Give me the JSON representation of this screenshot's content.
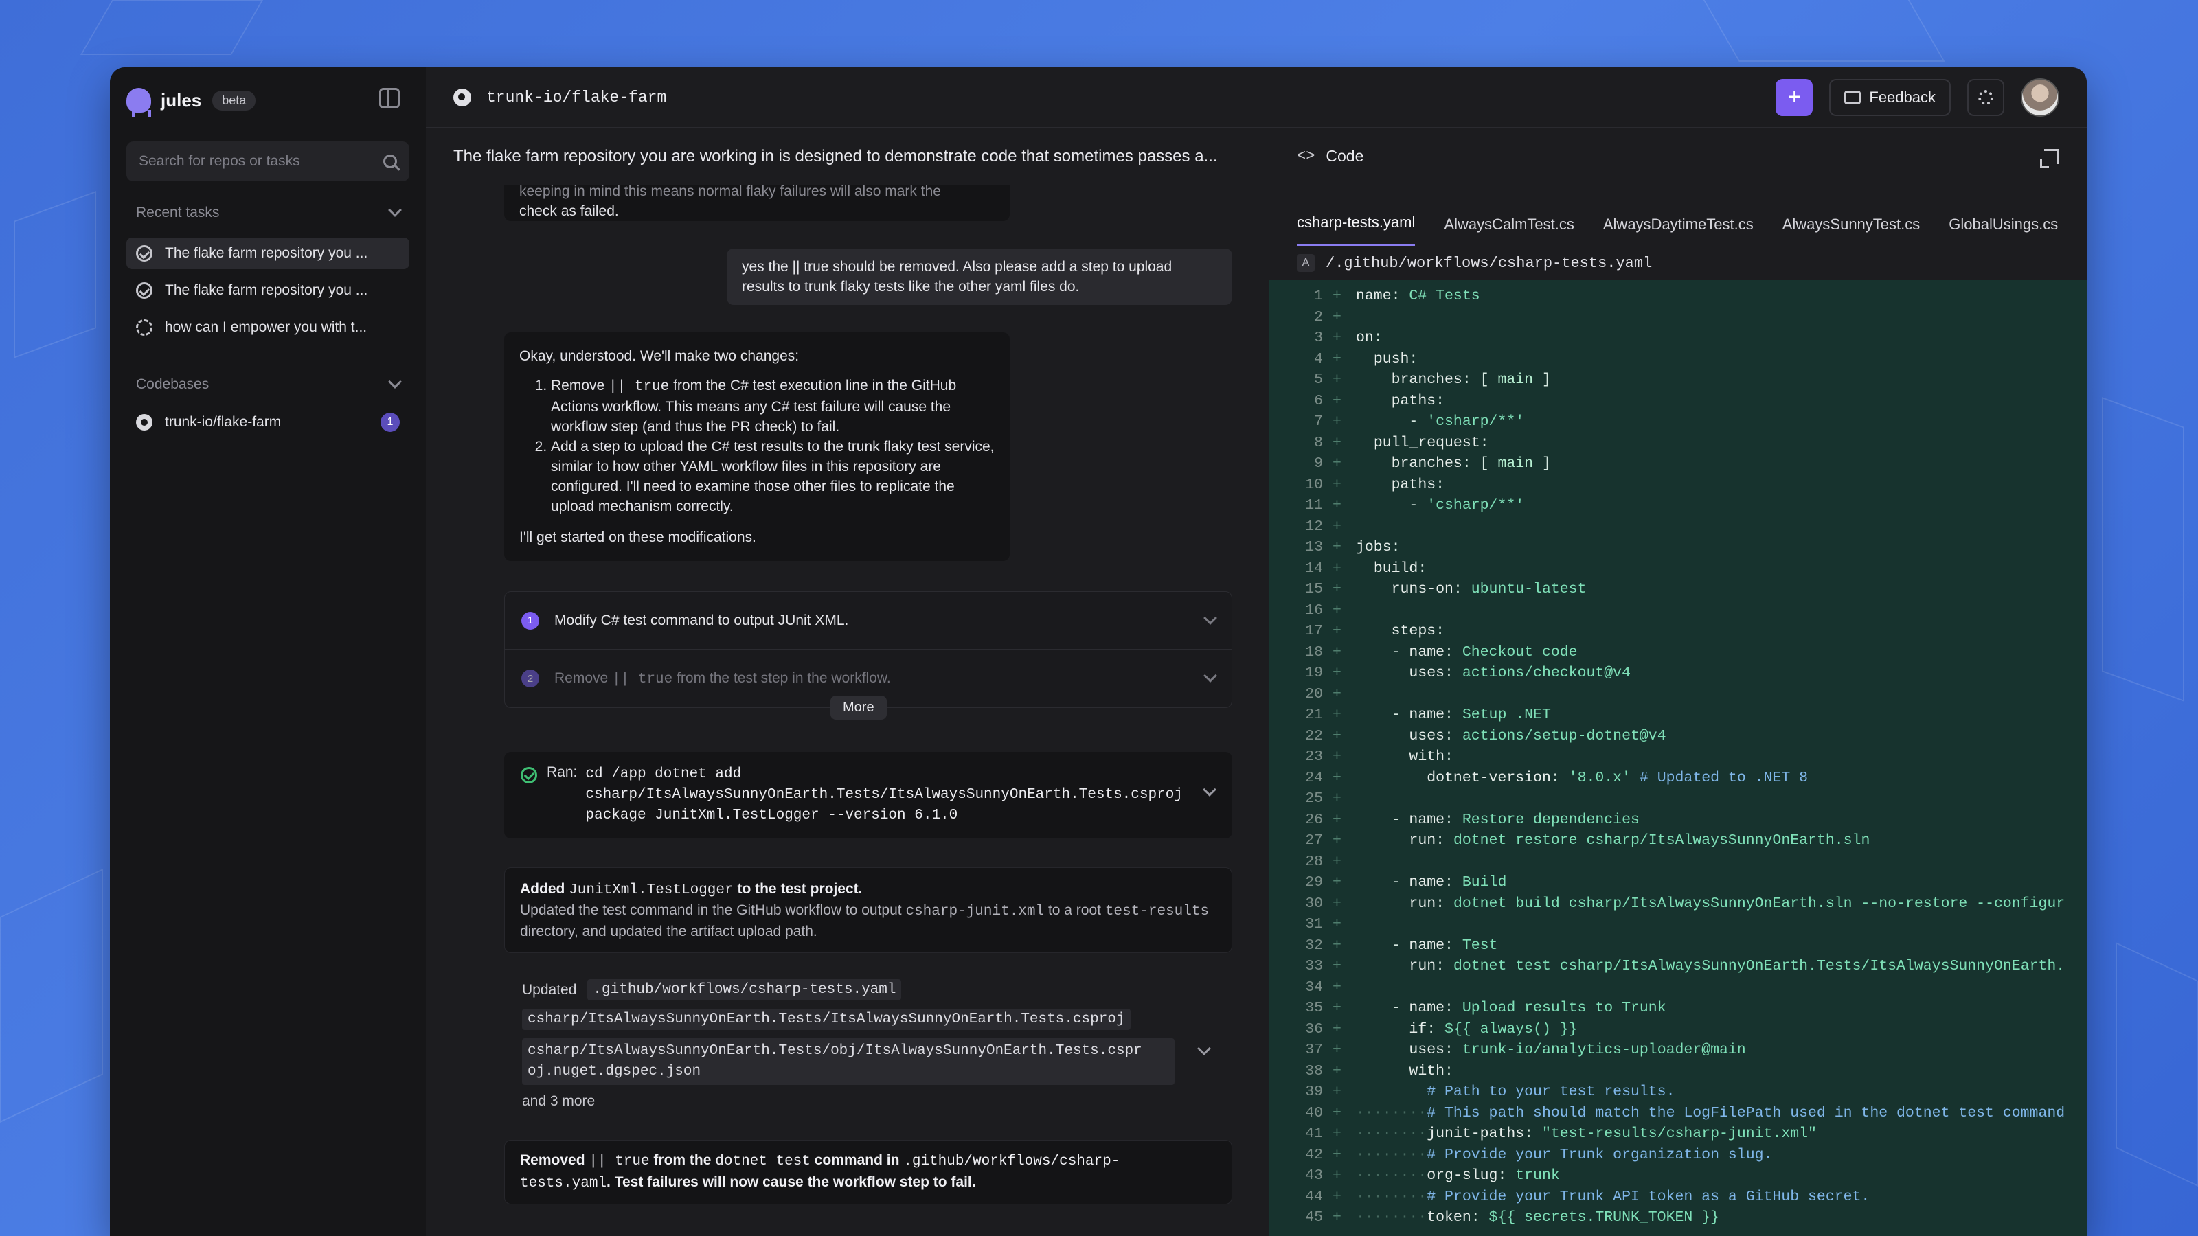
{
  "sidebar": {
    "brand": "jules",
    "badge": "beta",
    "search_placeholder": "Search for repos or tasks",
    "recent_tasks_label": "Recent tasks",
    "tasks": [
      {
        "label": "The flake farm repository you ...",
        "status": "done"
      },
      {
        "label": "The flake farm repository you ...",
        "status": "done"
      },
      {
        "label": "how can I empower you with t...",
        "status": "syncing"
      }
    ],
    "codebases_label": "Codebases",
    "codebases": [
      {
        "name": "trunk-io/flake-farm",
        "count": "1"
      }
    ]
  },
  "topbar": {
    "repo": "trunk-io/flake-farm",
    "plus": "+",
    "feedback": "Feedback"
  },
  "chat": {
    "title": "The flake farm repository you are working in is designed to demonstrate code that sometimes passes a...",
    "prev_agent_tail": {
      "ghost": "keeping in mind this means normal flaky failures will also mark the",
      "text": "check as failed."
    },
    "user_message": "yes the || true should be removed. Also please add a step to upload results to trunk flaky tests like the other yaml files do.",
    "agent_reply": {
      "intro": "Okay, understood. We'll make two changes:",
      "item1_a": "Remove ",
      "item1_code": "|| true",
      "item1_b": " from the C# test execution line in the GitHub Actions workflow. This means any C# test failure will cause the workflow step (and thus the PR check) to fail.",
      "item2": "Add a step to upload the C# test results to the trunk flaky test service, similar to how other YAML workflow files in this repository are configured. I'll need to examine those other files to replicate the upload mechanism correctly.",
      "outro": "I'll get started on these modifications."
    },
    "plan": {
      "steps": [
        {
          "num": "1",
          "text": "Modify C# test command to output JUnit XML."
        },
        {
          "num": "2",
          "text_a": "Remove ",
          "code": "|| true",
          "text_b": " from the test step in the workflow."
        }
      ],
      "more": "More"
    },
    "ran": {
      "label": "Ran:",
      "command": "cd /app dotnet add\ncsharp/ItsAlwaysSunnyOnEarth.Tests/ItsAlwaysSunnyOnEarth.Tests.csproj\npackage JunitXml.TestLogger --version 6.1.0"
    },
    "added": {
      "a": "Added ",
      "code": "JunitXml.TestLogger",
      "b": " to the test project.",
      "desc_a": "Updated the test command in the GitHub workflow to output ",
      "desc_code1": "csharp-junit.xml",
      "desc_b": " to a root ",
      "desc_code2": "test-results",
      "desc_c": " directory, and updated the artifact upload path."
    },
    "updated": {
      "label": "Updated",
      "files": [
        ".github/workflows/csharp-tests.yaml",
        "csharp/ItsAlwaysSunnyOnEarth.Tests/ItsAlwaysSunnyOnEarth.Tests.csproj",
        "csharp/ItsAlwaysSunnyOnEarth.Tests/obj/ItsAlwaysSunnyOnEarth.Tests.cspr\noj.nuget.dgspec.json"
      ],
      "and_more": "and 3 more"
    },
    "removed": {
      "a": "Removed ",
      "code1": "|| true",
      "b": " from the ",
      "code2": "dotnet test",
      "c": " command in ",
      "code3": ".github/workflows/csharp-\ntests.yaml",
      "d": ". Test failures will now cause the workflow step to fail."
    }
  },
  "code": {
    "header": "Code",
    "tabs": [
      "csharp-tests.yaml",
      "AlwaysCalmTest.cs",
      "AlwaysDaytimeTest.cs",
      "AlwaysSunnyTest.cs",
      "GlobalUsings.cs"
    ],
    "active_tab": 0,
    "file_badge": "A",
    "file_path": "/.github/workflows/csharp-tests.yaml",
    "lines": [
      [
        [
          "k",
          "name"
        ],
        [
          "p",
          ": "
        ],
        [
          "s",
          "C# Tests"
        ]
      ],
      [],
      [
        [
          "k",
          "on"
        ],
        [
          "p",
          ":"
        ]
      ],
      [
        [
          "p",
          "  "
        ],
        [
          "k",
          "push"
        ],
        [
          "p",
          ":"
        ]
      ],
      [
        [
          "p",
          "    "
        ],
        [
          "k",
          "branches"
        ],
        [
          "p",
          ": [ "
        ],
        [
          "v",
          "main"
        ],
        [
          "p",
          " ]"
        ]
      ],
      [
        [
          "p",
          "    "
        ],
        [
          "k",
          "paths"
        ],
        [
          "p",
          ":"
        ]
      ],
      [
        [
          "p",
          "      - "
        ],
        [
          "s",
          "'csharp/**'"
        ]
      ],
      [
        [
          "p",
          "  "
        ],
        [
          "k",
          "pull_request"
        ],
        [
          "p",
          ":"
        ]
      ],
      [
        [
          "p",
          "    "
        ],
        [
          "k",
          "branches"
        ],
        [
          "p",
          ": [ "
        ],
        [
          "v",
          "main"
        ],
        [
          "p",
          " ]"
        ]
      ],
      [
        [
          "p",
          "    "
        ],
        [
          "k",
          "paths"
        ],
        [
          "p",
          ":"
        ]
      ],
      [
        [
          "p",
          "      - "
        ],
        [
          "s",
          "'csharp/**'"
        ]
      ],
      [],
      [
        [
          "k",
          "jobs"
        ],
        [
          "p",
          ":"
        ]
      ],
      [
        [
          "p",
          "  "
        ],
        [
          "k",
          "build"
        ],
        [
          "p",
          ":"
        ]
      ],
      [
        [
          "p",
          "    "
        ],
        [
          "k",
          "runs-on"
        ],
        [
          "p",
          ": "
        ],
        [
          "s",
          "ubuntu-latest"
        ]
      ],
      [],
      [
        [
          "p",
          "    "
        ],
        [
          "k",
          "steps"
        ],
        [
          "p",
          ":"
        ]
      ],
      [
        [
          "p",
          "    - "
        ],
        [
          "k",
          "name"
        ],
        [
          "p",
          ": "
        ],
        [
          "s",
          "Checkout code"
        ]
      ],
      [
        [
          "p",
          "      "
        ],
        [
          "k",
          "uses"
        ],
        [
          "p",
          ": "
        ],
        [
          "s",
          "actions/checkout@v4"
        ]
      ],
      [],
      [
        [
          "p",
          "    - "
        ],
        [
          "k",
          "name"
        ],
        [
          "p",
          ": "
        ],
        [
          "s",
          "Setup .NET"
        ]
      ],
      [
        [
          "p",
          "      "
        ],
        [
          "k",
          "uses"
        ],
        [
          "p",
          ": "
        ],
        [
          "s",
          "actions/setup-dotnet@v4"
        ]
      ],
      [
        [
          "p",
          "      "
        ],
        [
          "k",
          "with"
        ],
        [
          "p",
          ":"
        ]
      ],
      [
        [
          "p",
          "        "
        ],
        [
          "k",
          "dotnet-version"
        ],
        [
          "p",
          ": "
        ],
        [
          "s",
          "'8.0.x'"
        ],
        [
          "c",
          " # Updated to .NET 8"
        ]
      ],
      [],
      [
        [
          "p",
          "    - "
        ],
        [
          "k",
          "name"
        ],
        [
          "p",
          ": "
        ],
        [
          "s",
          "Restore dependencies"
        ]
      ],
      [
        [
          "p",
          "      "
        ],
        [
          "k",
          "run"
        ],
        [
          "p",
          ": "
        ],
        [
          "s",
          "dotnet restore csharp/ItsAlwaysSunnyOnEarth.sln"
        ]
      ],
      [],
      [
        [
          "p",
          "    - "
        ],
        [
          "k",
          "name"
        ],
        [
          "p",
          ": "
        ],
        [
          "s",
          "Build"
        ]
      ],
      [
        [
          "p",
          "      "
        ],
        [
          "k",
          "run"
        ],
        [
          "p",
          ": "
        ],
        [
          "s",
          "dotnet build csharp/ItsAlwaysSunnyOnEarth.sln --no-restore --configur"
        ]
      ],
      [],
      [
        [
          "p",
          "    - "
        ],
        [
          "k",
          "name"
        ],
        [
          "p",
          ": "
        ],
        [
          "s",
          "Test"
        ]
      ],
      [
        [
          "p",
          "      "
        ],
        [
          "k",
          "run"
        ],
        [
          "p",
          ": "
        ],
        [
          "s",
          "dotnet test csharp/ItsAlwaysSunnyOnEarth.Tests/ItsAlwaysSunnyOnEarth."
        ]
      ],
      [],
      [
        [
          "p",
          "    - "
        ],
        [
          "k",
          "name"
        ],
        [
          "p",
          ": "
        ],
        [
          "s",
          "Upload results to Trunk"
        ]
      ],
      [
        [
          "p",
          "      "
        ],
        [
          "k",
          "if"
        ],
        [
          "p",
          ": "
        ],
        [
          "s",
          "${{ always() }}"
        ]
      ],
      [
        [
          "p",
          "      "
        ],
        [
          "k",
          "uses"
        ],
        [
          "p",
          ": "
        ],
        [
          "s",
          "trunk-io/analytics-uploader@main"
        ]
      ],
      [
        [
          "p",
          "      "
        ],
        [
          "k",
          "with"
        ],
        [
          "p",
          ":"
        ]
      ],
      [
        [
          "p",
          "        "
        ],
        [
          "c",
          "# Path to your test results."
        ]
      ],
      [
        [
          "w",
          "········"
        ],
        [
          "c",
          "# This path should match the LogFilePath used in the dotnet test command"
        ]
      ],
      [
        [
          "w",
          "········"
        ],
        [
          "k",
          "junit-paths"
        ],
        [
          "p",
          ": "
        ],
        [
          "s",
          "\"test-results/csharp-junit.xml\""
        ]
      ],
      [
        [
          "w",
          "········"
        ],
        [
          "c",
          "# Provide your Trunk organization slug."
        ]
      ],
      [
        [
          "w",
          "········"
        ],
        [
          "k",
          "org-slug"
        ],
        [
          "p",
          ": "
        ],
        [
          "s",
          "trunk"
        ]
      ],
      [
        [
          "w",
          "········"
        ],
        [
          "c",
          "# Provide your Trunk API token as a GitHub secret."
        ]
      ],
      [
        [
          "w",
          "········"
        ],
        [
          "k",
          "token"
        ],
        [
          "p",
          ": "
        ],
        [
          "s",
          "${{ secrets.TRUNK_TOKEN }}"
        ]
      ]
    ]
  }
}
